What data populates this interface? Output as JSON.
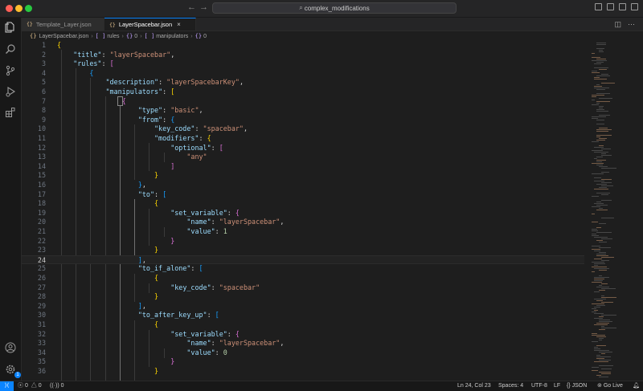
{
  "window": {
    "title": "complex_modifications"
  },
  "tabs": [
    {
      "label": "Template_Layer.json",
      "active": false
    },
    {
      "label": "LayerSpacebar.json",
      "active": true,
      "close": "×"
    }
  ],
  "breadcrumb": {
    "file": "LayerSpacebar.json",
    "rules": "rules",
    "idx0": "0",
    "manipulators": "manipulators",
    "idx1": "0"
  },
  "editor": {
    "current_line": 24,
    "lines": [
      {
        "n": "1"
      },
      {
        "n": "2"
      },
      {
        "n": "3"
      },
      {
        "n": "4"
      },
      {
        "n": "5"
      },
      {
        "n": "6"
      },
      {
        "n": "7"
      },
      {
        "n": "8"
      },
      {
        "n": "9"
      },
      {
        "n": "10"
      },
      {
        "n": "11"
      },
      {
        "n": "12"
      },
      {
        "n": "13"
      },
      {
        "n": "14"
      },
      {
        "n": "15"
      },
      {
        "n": "16"
      },
      {
        "n": "17"
      },
      {
        "n": "18"
      },
      {
        "n": "19"
      },
      {
        "n": "20"
      },
      {
        "n": "21"
      },
      {
        "n": "22"
      },
      {
        "n": "23"
      },
      {
        "n": "24"
      },
      {
        "n": "25"
      },
      {
        "n": "26"
      },
      {
        "n": "27"
      },
      {
        "n": "28"
      },
      {
        "n": "29"
      },
      {
        "n": "30"
      },
      {
        "n": "31"
      },
      {
        "n": "32"
      },
      {
        "n": "33"
      },
      {
        "n": "34"
      },
      {
        "n": "35"
      },
      {
        "n": "36"
      }
    ],
    "tokens": {
      "title_key": "\"title\"",
      "title_val": "\"layerSpacebar\"",
      "rules_key": "\"rules\"",
      "desc_key": "\"description\"",
      "desc_val": "\"layerSpacebarKey\"",
      "manip_key": "\"manipulators\"",
      "type_key": "\"type\"",
      "type_val": "\"basic\"",
      "from_key": "\"from\"",
      "keycode_key": "\"key_code\"",
      "keycode_val": "\"spacebar\"",
      "modifiers_key": "\"modifiers\"",
      "optional_key": "\"optional\"",
      "any_val": "\"any\"",
      "to_key": "\"to\"",
      "setvar_key": "\"set_variable\"",
      "name_key": "\"name\"",
      "name_val": "\"layerSpacebar\"",
      "value_key": "\"value\"",
      "value_1": "1",
      "value_0": "0",
      "toifalone_key": "\"to_if_alone\"",
      "toafter_key": "\"to_after_key_up\""
    }
  },
  "statusbar": {
    "errors": "0",
    "warnings": "0",
    "ports": "0",
    "position": "Ln 24, Col 23",
    "spaces": "Spaces: 4",
    "encoding": "UTF-8",
    "eol": "LF",
    "language": "JSON",
    "golive": "Go Live"
  },
  "icons": {
    "explorer": "files-icon",
    "search": "search-icon",
    "scm": "source-control-icon",
    "debug": "run-debug-icon",
    "extensions": "extensions-icon",
    "account": "account-icon",
    "settings": "gear-icon"
  },
  "colors": {
    "accent": "#0a84ff",
    "key": "#9cdcfe",
    "string": "#ce9178",
    "number": "#b5cea8",
    "bracket1": "#ffd700",
    "bracket2": "#da70d6",
    "bracket3": "#179fff"
  }
}
